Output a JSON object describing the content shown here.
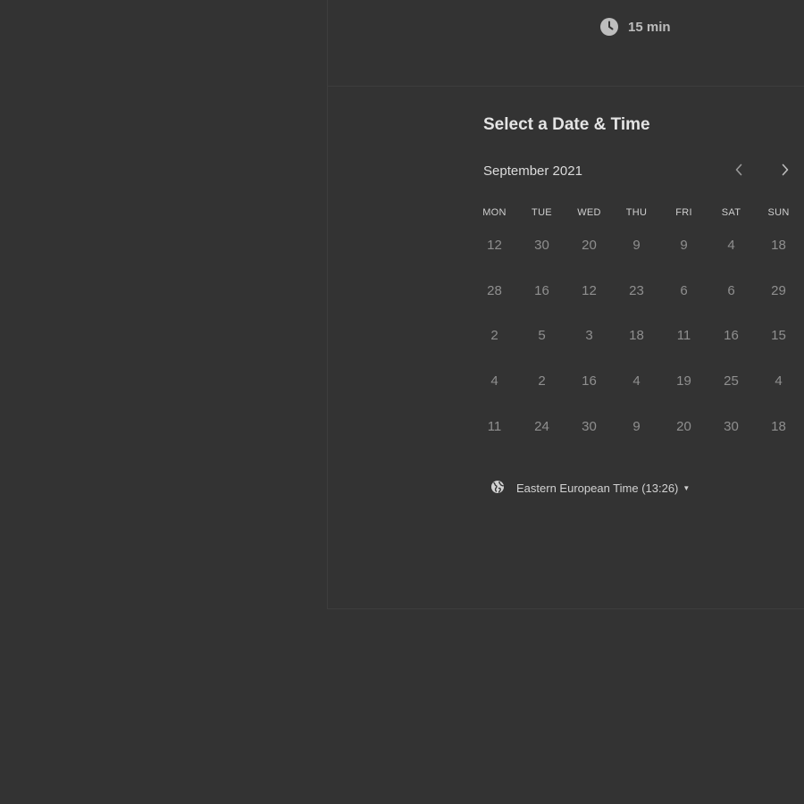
{
  "event": {
    "duration": "15 min",
    "duration_icon": "clock-icon"
  },
  "scheduler": {
    "title": "Select a Date & Time",
    "month_label": "September 2021",
    "prev_icon": "chevron-left-icon",
    "next_icon": "chevron-right-icon",
    "weekdays": [
      "MON",
      "TUE",
      "WED",
      "THU",
      "FRI",
      "SAT",
      "SUN"
    ],
    "weeks": [
      [
        "12",
        "30",
        "20",
        "9",
        "9",
        "4",
        "18"
      ],
      [
        "28",
        "16",
        "12",
        "23",
        "6",
        "6",
        "29"
      ],
      [
        "2",
        "5",
        "3",
        "18",
        "11",
        "16",
        "15"
      ],
      [
        "4",
        "2",
        "16",
        "4",
        "19",
        "25",
        "4"
      ],
      [
        "11",
        "24",
        "30",
        "9",
        "20",
        "30",
        "18"
      ]
    ],
    "timezone": {
      "icon": "globe-icon",
      "label": "Eastern European Time (13:26)",
      "caret_icon": "caret-down-icon"
    }
  },
  "colors": {
    "background": "#333333",
    "title": "#e4e4e4",
    "day_text": "#8f8f8f",
    "border": "#3d3d3d"
  }
}
